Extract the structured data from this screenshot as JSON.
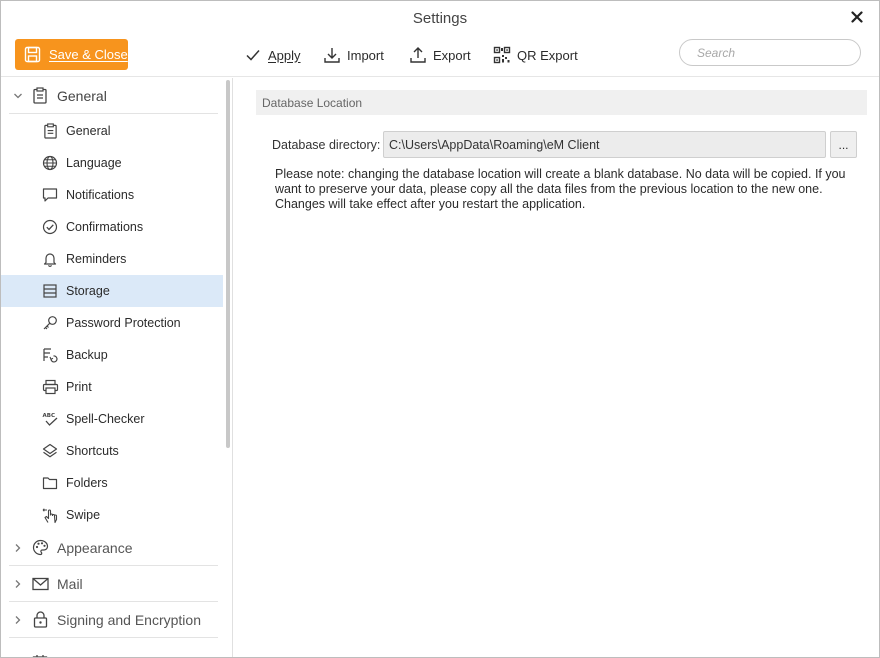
{
  "window": {
    "title": "Settings"
  },
  "toolbar": {
    "save_close": "Save & Close",
    "apply": "Apply",
    "import": "Import",
    "export": "Export",
    "qr_export": "QR Export",
    "search_placeholder": "Search"
  },
  "sidebar": {
    "general_group": "General",
    "items": [
      {
        "label": "General",
        "icon": "clipboard-icon"
      },
      {
        "label": "Language",
        "icon": "globe-icon"
      },
      {
        "label": "Notifications",
        "icon": "speech-bubble-icon"
      },
      {
        "label": "Confirmations",
        "icon": "check-circle-icon"
      },
      {
        "label": "Reminders",
        "icon": "bell-icon"
      },
      {
        "label": "Storage",
        "icon": "database-icon"
      },
      {
        "label": "Password Protection",
        "icon": "key-icon"
      },
      {
        "label": "Backup",
        "icon": "backup-icon"
      },
      {
        "label": "Print",
        "icon": "printer-icon"
      },
      {
        "label": "Spell-Checker",
        "icon": "spell-check-icon"
      },
      {
        "label": "Shortcuts",
        "icon": "layers-icon"
      },
      {
        "label": "Folders",
        "icon": "folder-icon"
      },
      {
        "label": "Swipe",
        "icon": "hand-pointer-icon"
      }
    ],
    "selected": "Storage",
    "groups": [
      {
        "label": "Appearance",
        "icon": "palette-icon"
      },
      {
        "label": "Mail",
        "icon": "envelope-icon"
      },
      {
        "label": "Signing and Encryption",
        "icon": "lock-icon"
      }
    ]
  },
  "main": {
    "section_title": "Database Location",
    "directory_label": "Database directory:",
    "directory_value": "C:\\Users\\AppData\\Roaming\\eM Client",
    "browse_label": "...",
    "note_line1": "Please note: changing the database location will create a blank database. No data will be copied. If you want to preserve your data, please copy all the data files from the previous location to the new one.",
    "note_line2": "Changes will take effect after you restart the application."
  },
  "colors": {
    "accent": "#f7941d",
    "selected_bg": "#dbe9f8",
    "section_bg": "#f0f0f0"
  }
}
